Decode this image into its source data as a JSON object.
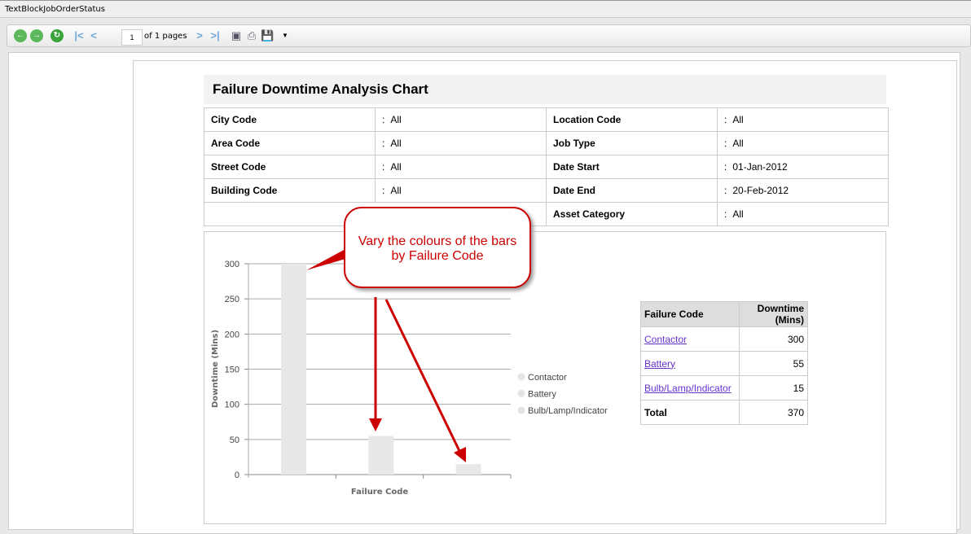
{
  "window": {
    "title": "TextBlockJobOrderStatus"
  },
  "toolbar": {
    "page_value": "1",
    "page_of": "of 1 pages"
  },
  "report": {
    "title": "Failure Downtime Analysis Chart",
    "params": [
      [
        {
          "label": "City Code",
          "value": "All"
        },
        {
          "label": "Location Code",
          "value": "All"
        }
      ],
      [
        {
          "label": "Area Code",
          "value": "All"
        },
        {
          "label": "Job Type",
          "value": "All"
        }
      ],
      [
        {
          "label": "Street Code",
          "value": "All"
        },
        {
          "label": "Date Start",
          "value": "01-Jan-2012"
        }
      ],
      [
        {
          "label": "Building Code",
          "value": "All"
        },
        {
          "label": "Date End",
          "value": "20-Feb-2012"
        }
      ],
      [
        {
          "label": "",
          "value": ""
        },
        {
          "label": "Asset Category",
          "value": "All"
        }
      ]
    ],
    "sep": ":"
  },
  "callout": {
    "text1": "Vary the colours of the bars",
    "text2": "by Failure Code"
  },
  "chart_data": {
    "type": "bar",
    "categories": [
      "Contactor",
      "Battery",
      "Bulb/Lamp/Indicator"
    ],
    "values": [
      300,
      55,
      15
    ],
    "xlabel": "Failure Code",
    "ylabel": "Downtime (Mins)",
    "ylim": [
      0,
      300
    ],
    "yticks": [
      "0",
      "50",
      "100",
      "150",
      "200",
      "250",
      "300"
    ],
    "legend": [
      "Contactor",
      "Battery",
      "Bulb/Lamp/Indicator"
    ],
    "legend_position": "right",
    "bar_color": "#e8e8e8"
  },
  "summary": {
    "headers": [
      "Failure Code",
      "Downtime",
      "(Mins)"
    ],
    "rows": [
      {
        "code": "Contactor",
        "value": "300"
      },
      {
        "code": "Battery",
        "value": "55"
      },
      {
        "code": "Bulb/Lamp/Indicator",
        "value": "15"
      }
    ],
    "total_label": "Total",
    "total_value": "370"
  }
}
